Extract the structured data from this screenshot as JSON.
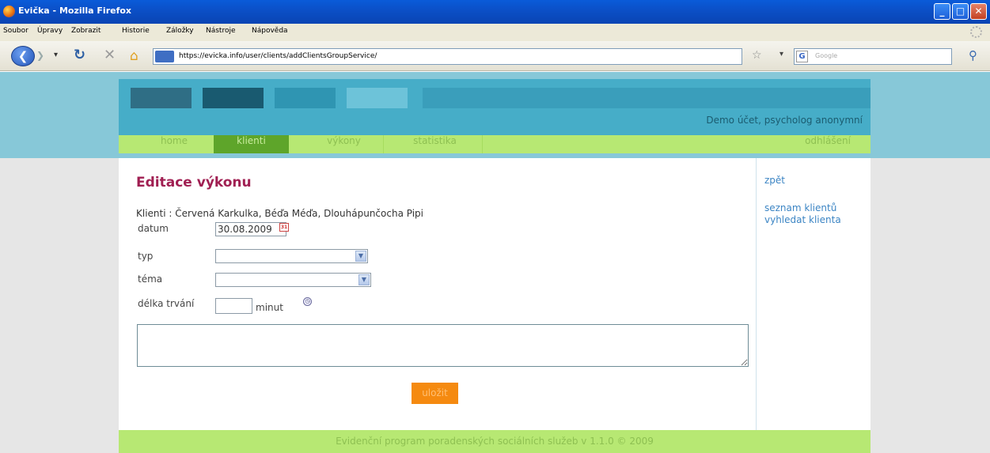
{
  "window": {
    "title": "Evička - Mozilla Firefox",
    "controls": {
      "minimize": "_",
      "maximize": "□",
      "close": "✕"
    }
  },
  "menubar": {
    "items": [
      "Soubor",
      "Úpravy",
      "Zobrazit",
      "Historie",
      "Záložky",
      "Nástroje",
      "Nápověda"
    ]
  },
  "navbar": {
    "url": "https://evicka.info/user/clients/addClientsGroupService/",
    "search_placeholder": "Google",
    "search_engine_letter": "G"
  },
  "header": {
    "user_info": "Demo účet, psycholog anonymní"
  },
  "topnav": {
    "home": "home",
    "klienti": "klienti",
    "vykony": "výkony",
    "statistika": "statistika",
    "odhlaseni": "odhlášení",
    "active": "klienti"
  },
  "form": {
    "title": "Editace výkonu",
    "clients_line": "Klienti : Červená Karkulka, Béďa Méďa, Dlouhápunčocha Pipi",
    "datum_label": "datum",
    "datum_value": "30.08.2009",
    "typ_label": "typ",
    "typ_value": "",
    "tema_label": "téma",
    "tema_value": "",
    "delka_label": "délka trvání",
    "delka_value": "",
    "minut_label": "minut",
    "note_value": "",
    "save_label": "uložit"
  },
  "sidebar": {
    "back": "zpět",
    "client_list": "seznam klientů",
    "search_client": "vyhledat klienta"
  },
  "footer": {
    "text": "Evidenční program poradenských sociálních služeb v 1.1.0 © 2009"
  },
  "colors": {
    "title_accent": "#a01f52",
    "nav_green": "#b7e873",
    "nav_active": "#5ea52a",
    "header_teal": "#46adc8",
    "save_orange": "#f58a10",
    "link_blue": "#3c85c4"
  },
  "icons": {
    "calendar": "calendar-icon",
    "clock": "clock-icon",
    "select_arrow": "chevron-down-icon"
  }
}
